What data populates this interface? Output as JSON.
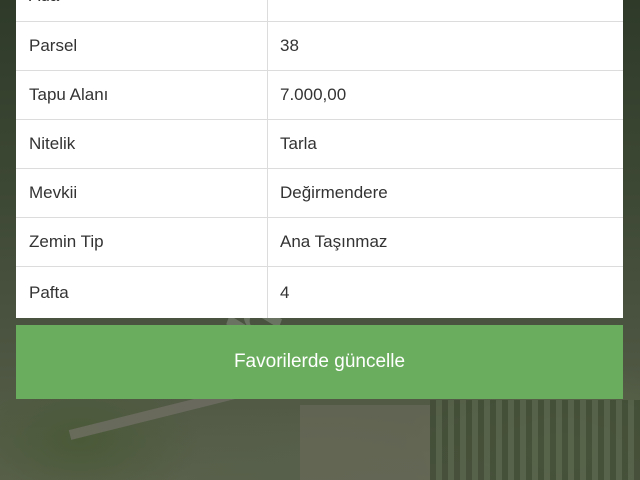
{
  "property_table": {
    "rows": [
      {
        "label": "Ada",
        "value": ""
      },
      {
        "label": "Parsel",
        "value": "38"
      },
      {
        "label": "Tapu Alanı",
        "value": "7.000,00"
      },
      {
        "label": "Nitelik",
        "value": "Tarla"
      },
      {
        "label": "Mevkii",
        "value": "Değirmendere"
      },
      {
        "label": "Zemin Tip",
        "value": "Ana Taşınmaz"
      },
      {
        "label": "Pafta",
        "value": "4"
      }
    ]
  },
  "actions": {
    "update_favorites_label": "Favorilerde güncelle"
  },
  "watermark": {
    "text": "hep"
  },
  "colors": {
    "button_green": "#6aad5e",
    "card_bg": "#ffffff",
    "divider": "#dcdcdc"
  }
}
